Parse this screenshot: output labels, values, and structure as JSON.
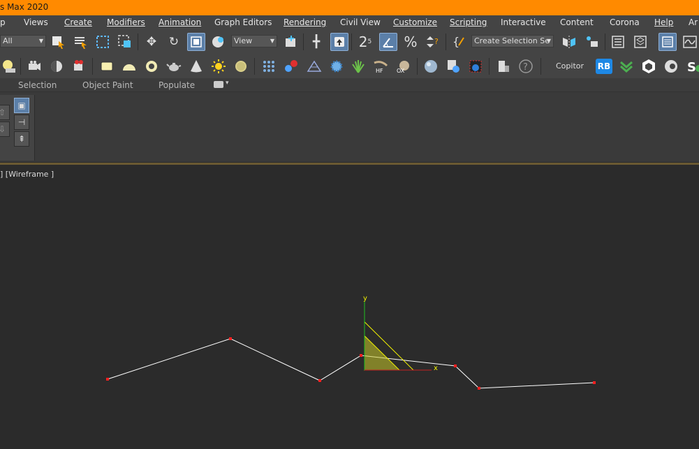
{
  "title_bar": {
    "text": "s Max 2020"
  },
  "menu": {
    "items": [
      "p",
      "Views",
      "Create",
      "Modifiers",
      "Animation",
      "Graph Editors",
      "Rendering",
      "Civil View",
      "Customize",
      "Scripting",
      "Interactive",
      "Content",
      "Corona",
      "Help",
      "Ar"
    ]
  },
  "toolbar": {
    "selection_filter": "All",
    "ref_coord_system": "View",
    "named_selection_set": "Create Selection Se",
    "snap_label": "2",
    "snap_sub": "5",
    "icons": [
      "select-object-icon",
      "select-by-name-icon",
      "rect-selection-region-icon",
      "window-crossing-icon",
      "select-move-icon",
      "select-rotate-icon",
      "select-scale-icon",
      "placement-icon",
      "pivot-center-icon",
      "select-manipulate-icon",
      "snaps-toggle-icon",
      "angle-snap-icon",
      "percent-snap-icon",
      "spinner-snap-icon",
      "edit-named-selections-icon",
      "mirror-icon",
      "align-icon",
      "scene-explorer-icon",
      "layer-explorer-icon",
      "toggle-ribbon-icon",
      "curve-editor-icon"
    ]
  },
  "toolbar2": {
    "copitor_label": "Copitor",
    "rb_label": "RB",
    "hf_label": "HF",
    "ox_label": "OX",
    "icons": [
      "light-icon",
      "camera-icon",
      "sphere-half-icon",
      "render-icon",
      "plane-icon",
      "dome-icon",
      "ring-icon",
      "teapot-icon",
      "cone-icon",
      "sun-icon",
      "disc-icon",
      "grid-icon",
      "molecule-icon",
      "scatter-icon",
      "gear-object-icon",
      "grass-icon",
      "hair-icon",
      "fur-icon",
      "material-sphere-icon",
      "material-editor-icon",
      "render-frame-icon",
      "render-setup-icon",
      "help-icon"
    ]
  },
  "ribbon": {
    "tabs": [
      "Selection",
      "Object Paint",
      "Populate"
    ],
    "dropdown_glyph": "▾"
  },
  "viewport": {
    "label": "] [Wireframe ]",
    "gizmo_x_label": "x",
    "gizmo_y_label": "y"
  },
  "colors": {
    "title_bar": "#ff8a00",
    "spline": "#ffffff",
    "vertex": "#ff2020",
    "gizmo_yellow": "#f0f000",
    "axis_x": "#c02020",
    "axis_y": "#20c020"
  }
}
